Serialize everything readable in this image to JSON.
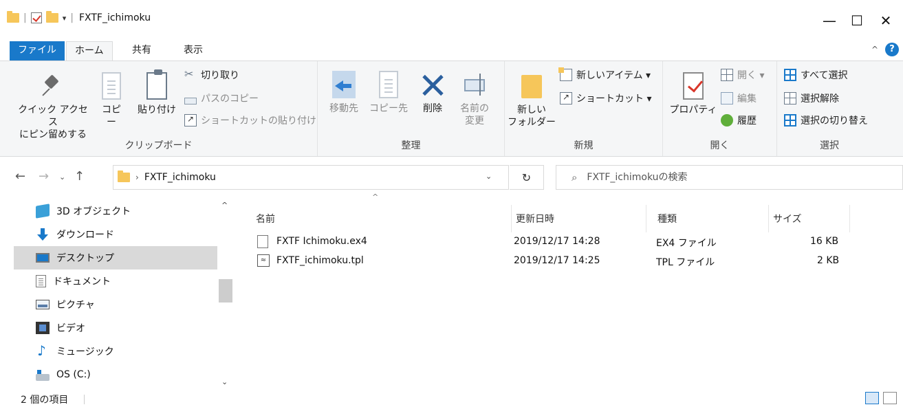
{
  "window": {
    "title": "FXTF_ichimoku",
    "minimize_glyph": "—",
    "maximize_glyph": "☐",
    "close_glyph": "✕"
  },
  "ribbon_tabs": [
    "ファイル",
    "ホーム",
    "共有",
    "表示"
  ],
  "ribbon": {
    "clipboard": {
      "label": "クリップボード",
      "pin_line1": "クイック アクセス",
      "pin_line2": "にピン留めする",
      "copy": "コピー",
      "paste": "貼り付け",
      "cut": "切り取り",
      "copy_path": "パスのコピー",
      "paste_shortcut": "ショートカットの貼り付け"
    },
    "organize": {
      "label": "整理",
      "move_to": "移動先",
      "copy_to": "コピー先",
      "delete": "削除",
      "rename_line1": "名前の",
      "rename_line2": "変更"
    },
    "new": {
      "label": "新規",
      "new_folder_line1": "新しい",
      "new_folder_line2": "フォルダー",
      "new_item": "新しいアイテム ▾",
      "shortcut": "ショートカット ▾"
    },
    "open": {
      "label": "開く",
      "properties": "プロパティ",
      "open": "開く ▾",
      "edit": "編集",
      "history": "履歴"
    },
    "select": {
      "label": "選択",
      "select_all": "すべて選択",
      "select_none": "選択解除",
      "invert": "選択の切り替え"
    }
  },
  "address": {
    "path": "FXTF_ichimoku",
    "search_placeholder": "FXTF_ichimokuの検索"
  },
  "nav_pane": {
    "items": [
      {
        "label": "3D オブジェクト",
        "icon": "3d-objects-icon"
      },
      {
        "label": "ダウンロード",
        "icon": "downloads-icon"
      },
      {
        "label": "デスクトップ",
        "icon": "desktop-icon",
        "selected": true
      },
      {
        "label": "ドキュメント",
        "icon": "documents-icon"
      },
      {
        "label": "ピクチャ",
        "icon": "pictures-icon"
      },
      {
        "label": "ビデオ",
        "icon": "videos-icon"
      },
      {
        "label": "ミュージック",
        "icon": "music-icon"
      },
      {
        "label": "OS (C:)",
        "icon": "drive-icon"
      }
    ]
  },
  "columns": {
    "name": "名前",
    "date": "更新日時",
    "type": "種類",
    "size": "サイズ"
  },
  "files": [
    {
      "name": "FXTF Ichimoku.ex4",
      "date": "2019/12/17 14:28",
      "type": "EX4 ファイル",
      "size": "16 KB",
      "icon": "file-icon"
    },
    {
      "name": "FXTF_ichimoku.tpl",
      "date": "2019/12/17 14:25",
      "type": "TPL ファイル",
      "size": "2 KB",
      "icon": "template-file-icon"
    }
  ],
  "status": {
    "item_count": "2 個の項目"
  },
  "colors": {
    "accent": "#1979ca",
    "folder": "#f6c65a",
    "ribbon_bg": "#f5f6f7",
    "selected_bg": "#d9d9d9"
  }
}
